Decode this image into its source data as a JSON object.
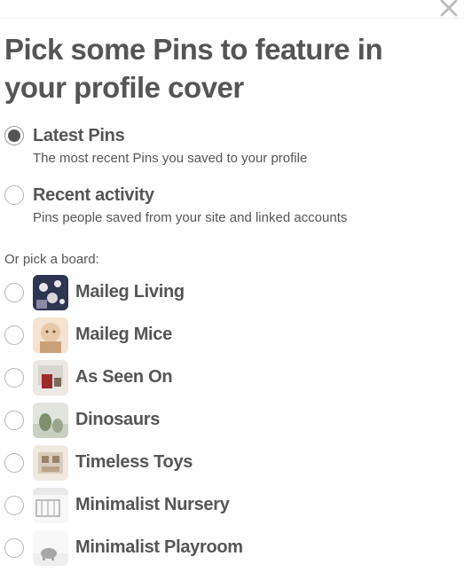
{
  "dialog": {
    "title": "Pick some Pins to feature in your profile cover",
    "close_icon": "close-icon"
  },
  "options": [
    {
      "label": "Latest Pins",
      "description": "The most recent Pins you saved to your profile",
      "checked": true
    },
    {
      "label": "Recent activity",
      "description": "Pins people saved from your site and linked accounts",
      "checked": false
    }
  ],
  "boards_heading": "Or pick a board:",
  "boards": [
    {
      "name": "Maileg Living",
      "thumb": [
        "#2e3550",
        "#e8e6ea",
        "#8a8aa0"
      ]
    },
    {
      "name": "Maileg Mice",
      "thumb": [
        "#e9c9a8",
        "#f3e3d0",
        "#caa07a"
      ]
    },
    {
      "name": "As Seen On",
      "thumb": [
        "#d9d4cf",
        "#9c2a2a",
        "#ece9e4"
      ]
    },
    {
      "name": "Dinosaurs",
      "thumb": [
        "#c9cfc2",
        "#7d8f6e",
        "#e2e4de"
      ]
    },
    {
      "name": "Timeless Toys",
      "thumb": [
        "#d8cdbd",
        "#9a8266",
        "#efe9df"
      ]
    },
    {
      "name": "Minimalist Nursery",
      "thumb": [
        "#e9e9e9",
        "#bdbdbd",
        "#f7f7f7"
      ]
    },
    {
      "name": "Minimalist Playroom",
      "thumb": [
        "#efefef",
        "#a7a7a7",
        "#f8f8f8"
      ]
    }
  ]
}
